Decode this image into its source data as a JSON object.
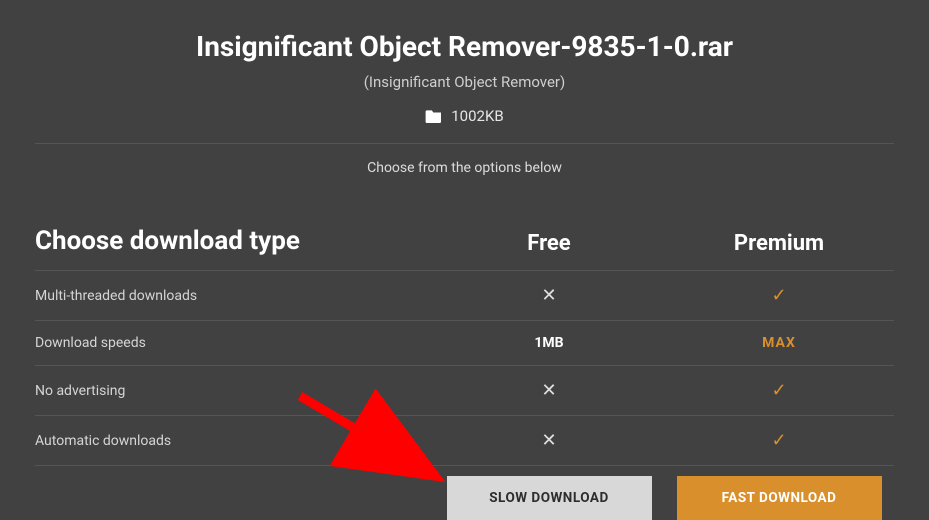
{
  "header": {
    "title": "Insignificant Object Remover-9835-1-0.rar",
    "subtitle": "(Insignificant Object Remover)",
    "filesize": "1002KB"
  },
  "instruction": "Choose from the options below",
  "table": {
    "heading": "Choose download type",
    "col_free": "Free",
    "col_premium": "Premium",
    "rows": [
      {
        "label": "Multi-threaded downloads",
        "free": "cross",
        "premium": "check"
      },
      {
        "label": "Download speeds",
        "free_text": "1MB",
        "premium_text": "MAX"
      },
      {
        "label": "No advertising",
        "free": "cross",
        "premium": "check"
      },
      {
        "label": "Automatic downloads",
        "free": "cross",
        "premium": "check"
      }
    ]
  },
  "buttons": {
    "slow": "SLOW DOWNLOAD",
    "fast": "FAST DOWNLOAD"
  }
}
